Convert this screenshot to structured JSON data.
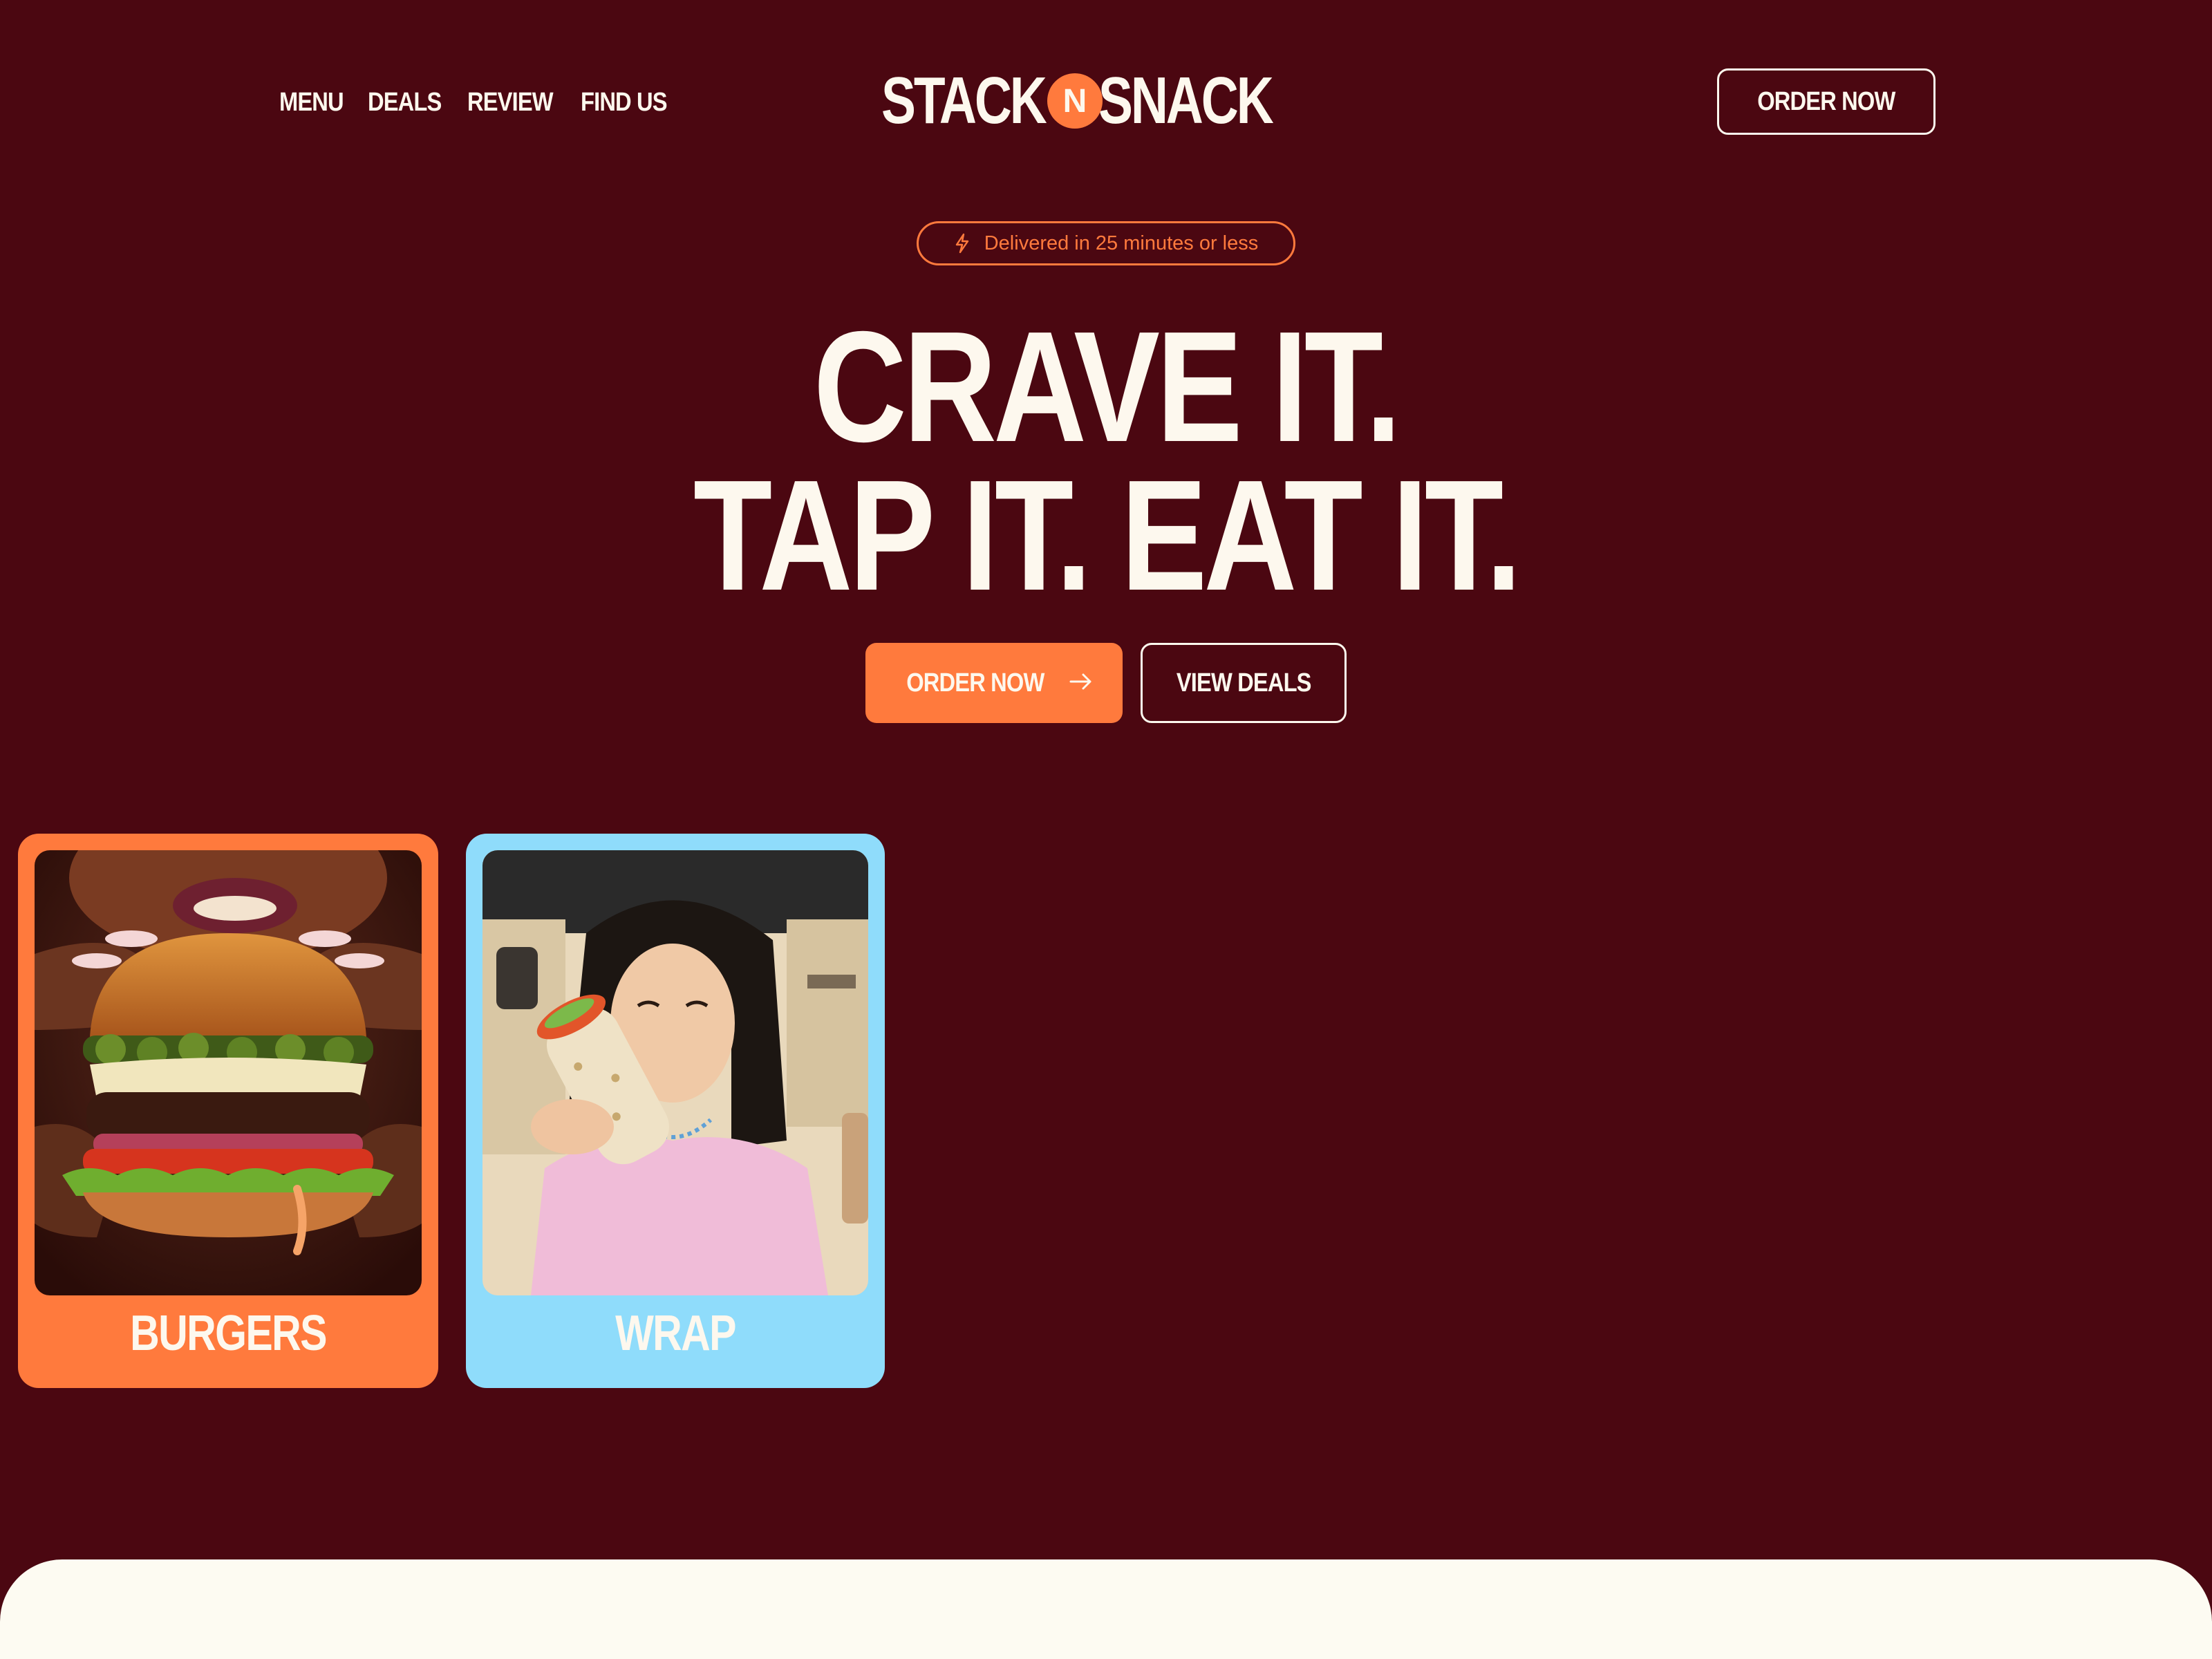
{
  "nav": {
    "links": [
      "MENU",
      "DEALS",
      "REVIEW",
      "FIND US"
    ],
    "logo": {
      "left": "STACK",
      "middle": "N",
      "right": "SNACK"
    },
    "order_button": "ORDER NOW"
  },
  "hero": {
    "badge": "Delivered in 25 minutes or less",
    "headline_line1": "CRAVE IT.",
    "headline_line2": "TAP IT. EAT IT.",
    "primary_cta": "ORDER NOW",
    "secondary_cta": "VIEW DEALS"
  },
  "categories": [
    {
      "label": "BURGERS",
      "color": "#ff7a3d"
    },
    {
      "label": "WRAP",
      "color": "#8fdcfb"
    }
  ],
  "colors": {
    "background": "#4b0711",
    "accent": "#ff7a3d",
    "text": "#fdf8ee",
    "panel": "#fdfbf2"
  },
  "icons": {
    "badge": "lightning-icon",
    "cta": "arrow-right-icon"
  }
}
